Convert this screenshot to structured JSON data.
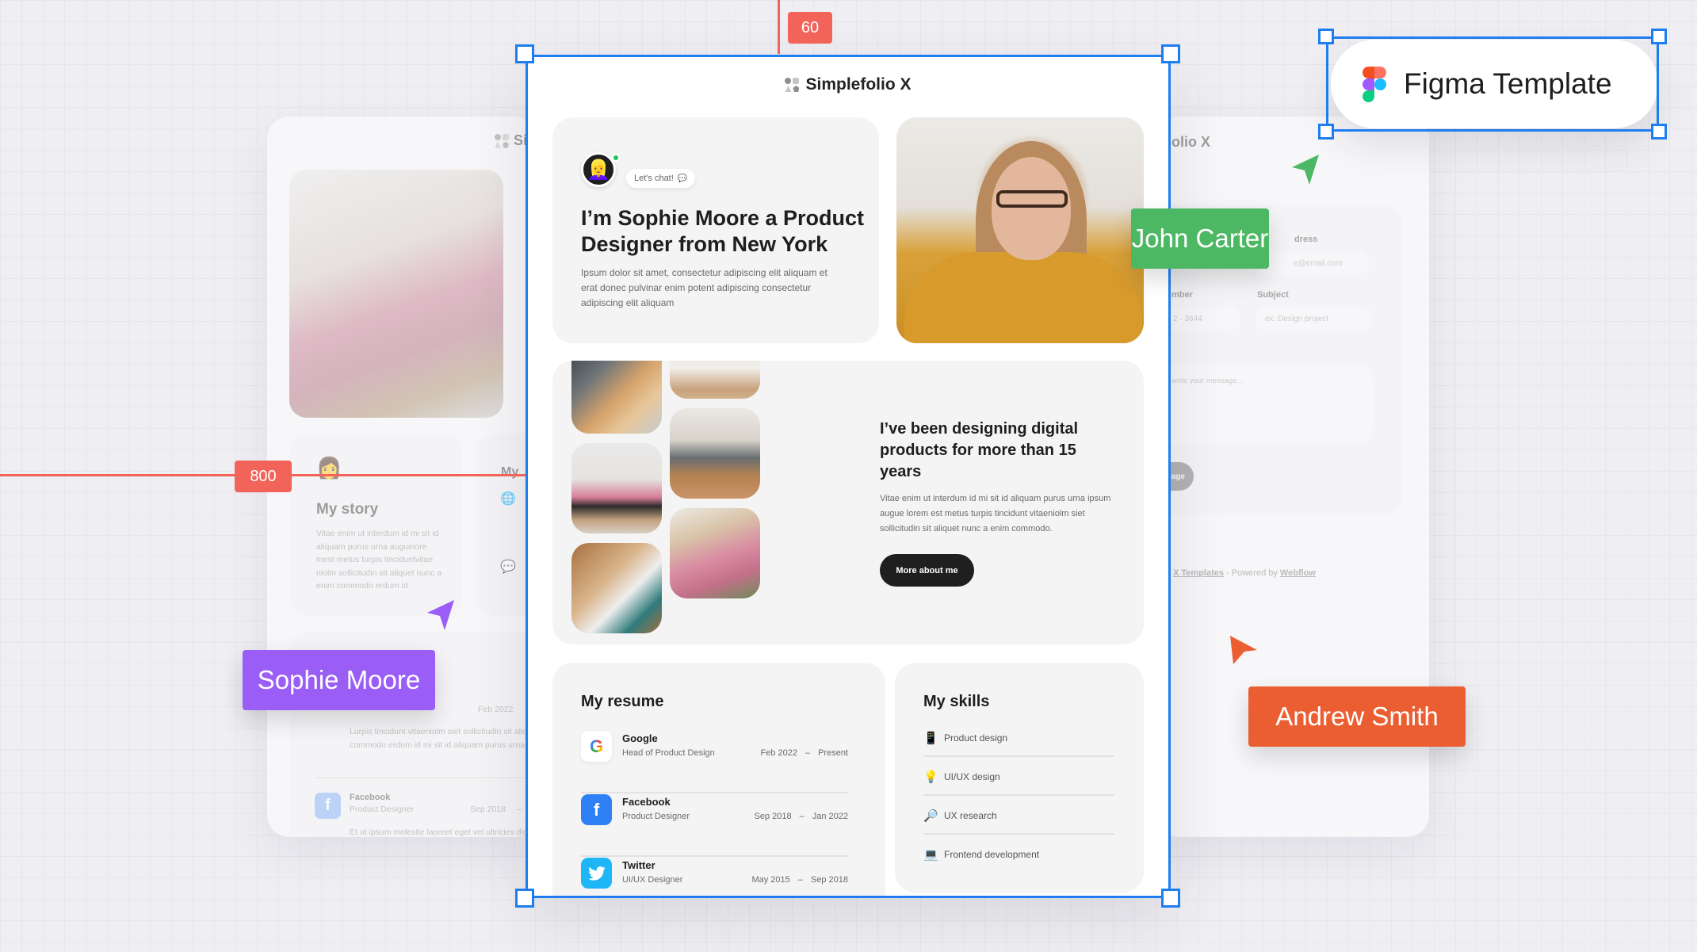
{
  "canvas": {
    "measure_top": "60",
    "measure_left": "800",
    "figma_badge": "Figma Template"
  },
  "collaborators": [
    {
      "name": "John Carter",
      "color": "#4db863"
    },
    {
      "name": "Sophie Moore",
      "color": "#9a5ef7"
    },
    {
      "name": "Andrew Smith",
      "color": "#eb5e32"
    }
  ],
  "colors": {
    "selection": "#1e7ef0",
    "measure": "#f2635a",
    "button_dark": "#1f1f1f"
  },
  "site": {
    "logo": "Simplefolio X",
    "hero": {
      "chat_label": "Let's chat!",
      "title": "I’m Sophie Moore a Product Designer from New York",
      "text": "Ipsum dolor sit amet, consectetur adipiscing elit aliquam et erat donec pulvinar enim potent adipiscing consectetur adipiscing elit aliquam"
    },
    "about": {
      "title": "I’ve been designing digital products for more than 15 years",
      "text": "Vitae enim ut interdum id mi sit id aliquam purus urna ipsum augue lorem est metus turpis tincidunt vitaeniolm siet sollicitudin sit aliquet nunc a enim commodo.",
      "button": "More about me"
    },
    "resume": {
      "title": "My resume",
      "items": [
        {
          "company": "Google",
          "role": "Head of Product Design",
          "start": "Feb 2022",
          "sep": "–",
          "end": "Present",
          "icon": "google-icon"
        },
        {
          "company": "Facebook",
          "role": "Product Designer",
          "start": "Sep 2018",
          "sep": "–",
          "end": "Jan 2022",
          "icon": "facebook-icon"
        },
        {
          "company": "Twitter",
          "role": "UI/UX Designer",
          "start": "May 2015",
          "sep": "–",
          "end": "Sep 2018",
          "icon": "twitter-icon"
        }
      ]
    },
    "skills": {
      "title": "My skills",
      "items": [
        {
          "label": "Product design",
          "icon": "📱"
        },
        {
          "label": "UI/UX design",
          "icon": "💡"
        },
        {
          "label": "UX research",
          "icon": "🔎"
        },
        {
          "label": "Frontend development",
          "icon": "💻"
        }
      ]
    }
  },
  "left_bg": {
    "logo": "Si",
    "story_title": "My story",
    "story_text": "Vitae enim ut interdum id mi sit id aliquam purus urna auguelore mest metus turpis tinciduntvitae niolm sollicitudin sit aliquet nunc a enim commodo erdum id",
    "side_title": "My",
    "exp1_date": "Feb 2022",
    "exp1_text": "Lurpis tincidunt vitaeniolm siet sollicitudin sit aliquet commodo erdum id mi sit id aliquam purus urna ip",
    "exp2_company": "Facebook",
    "exp2_role": "Product Designer",
    "exp2_date": "Sep 2018",
    "exp2_sep": "–",
    "exp2_text": "Et ut ipsum molestie laoreet eget vel ultricies dign nibhmagna urna aenean meipiscing sit sed facilisi"
  },
  "right_bg": {
    "logo": "olio X",
    "email_label": "dress",
    "email_placeholder": "e@email.com",
    "phone_label": "mber",
    "phone_placeholder": "2 - 3644",
    "subject_label": "Subject",
    "subject_placeholder": "ex. Design project",
    "message_placeholder": "write your message...",
    "send_button": "essage",
    "footer_templates": "X Templates",
    "footer_powered": " - Powered by ",
    "footer_webflow": "Webflow"
  }
}
